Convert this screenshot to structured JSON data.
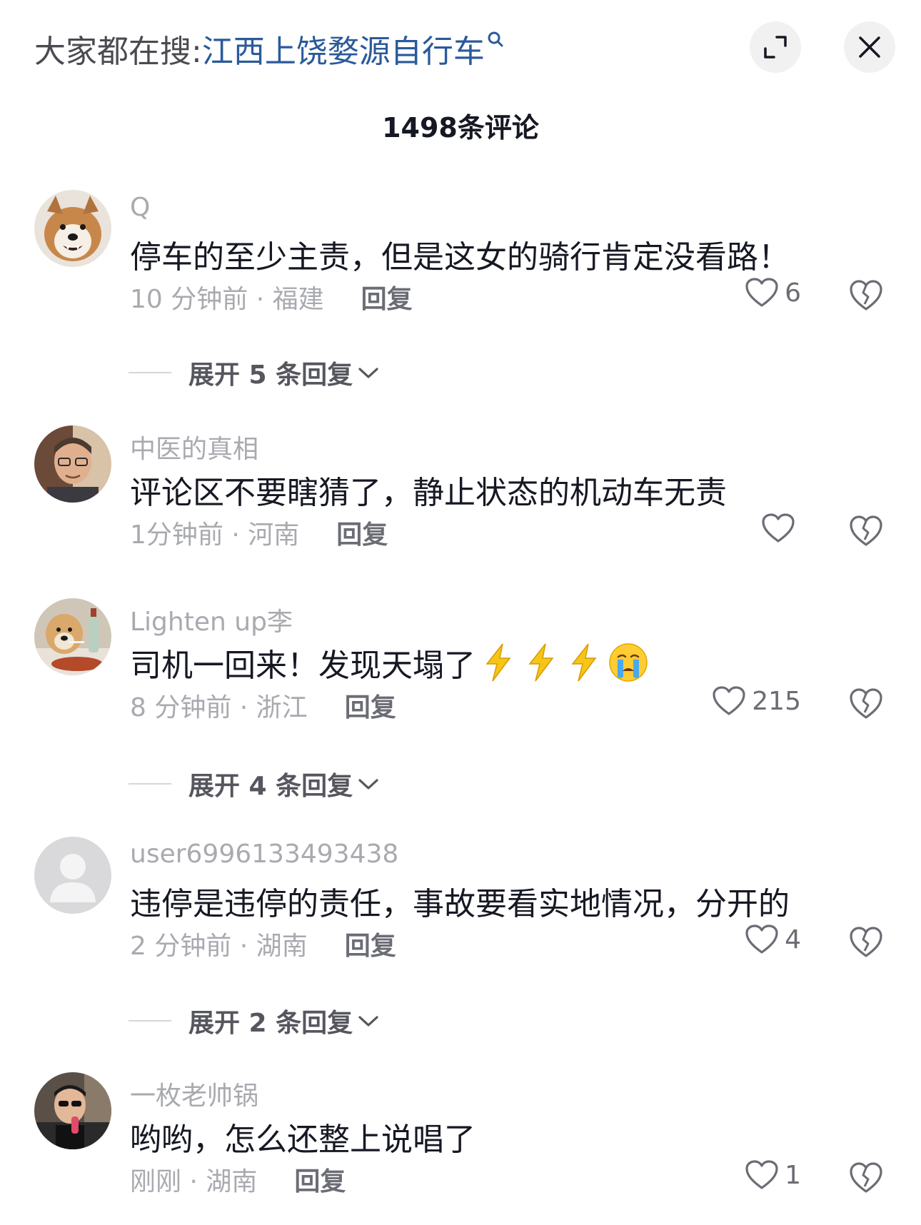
{
  "header": {
    "search_prefix": "大家都在搜:",
    "search_term": "江西上饶婺源自行车",
    "expand_icon": "expand-icon",
    "close_icon": "close-icon"
  },
  "comment_count": "1498条评论",
  "comments": [
    {
      "username": "Q",
      "text": "停车的至少主责，但是这女的骑行肯定没看路！",
      "meta": "10 分钟前 · 福建",
      "reply": "回复",
      "likes": "6",
      "expand": "展开 5 条回复"
    },
    {
      "username": "中医的真相",
      "text": "评论区不要瞎猜了，静止状态的机动车无责",
      "meta": "1分钟前 · 河南",
      "reply": "回复",
      "likes": ""
    },
    {
      "username": "Lighten up李",
      "text": "司机一回来！发现天塌了",
      "meta": "8 分钟前 · 浙江",
      "reply": "回复",
      "likes": "215",
      "expand": "展开 4 条回复",
      "emoji": [
        "lightning-emoji",
        "lightning-emoji",
        "lightning-emoji",
        "crying-face-emoji"
      ]
    },
    {
      "username": "user6996133493438",
      "text": "违停是违停的责任，事故要看实地情况，分开的",
      "meta": "2 分钟前 · 湖南",
      "reply": "回复",
      "likes": "4",
      "expand": "展开 2 条回复"
    },
    {
      "username": "一枚老帅锅",
      "text": "哟哟，怎么还整上说唱了",
      "meta": "刚刚 · 湖南",
      "reply": "回复",
      "likes": "1"
    }
  ],
  "colors": {
    "search_term": "#2a5a9a",
    "secondary_text": "#a9aab0",
    "primary_text": "#161823"
  }
}
